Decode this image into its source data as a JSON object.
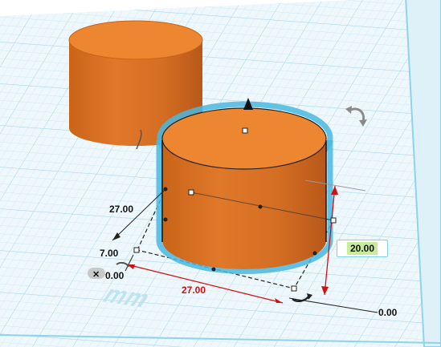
{
  "workplane": {
    "units_label": "mm",
    "grid_color": "#c6e4f1",
    "edge_color": "#8fd3ea"
  },
  "shapes": {
    "cylinder_color": "#e57e25",
    "selection_outline_color": "#49b8e2"
  },
  "dimensions": {
    "depth_value": "27.00",
    "length_value": "7.00",
    "x_position_value": "0.00",
    "width_value": "27.00",
    "height_value": "20.00",
    "elevation_value": "0.00"
  },
  "colors": {
    "dimension_red": "#d01010",
    "height_input_bg": "#c8ec9a"
  }
}
